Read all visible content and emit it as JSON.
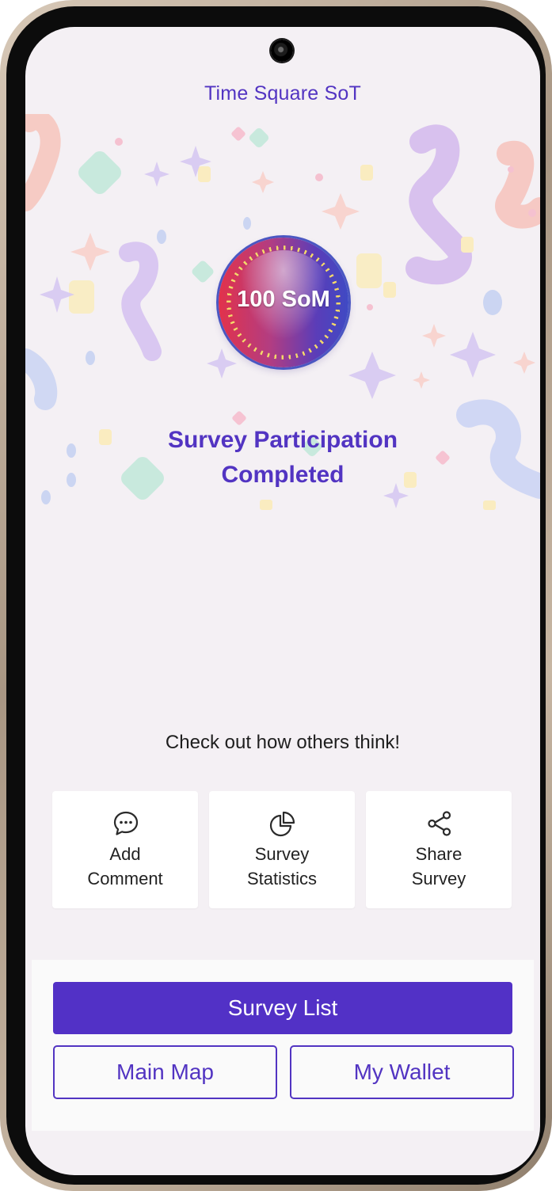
{
  "header": {
    "title": "Time Square SoT"
  },
  "badge": {
    "text": "100 SoM"
  },
  "completion": {
    "line1": "Survey Participation",
    "line2": "Completed"
  },
  "hint": "Check out how others think!",
  "actions": [
    {
      "icon": "comment-icon",
      "line1": "Add",
      "line2": "Comment"
    },
    {
      "icon": "pie-chart-icon",
      "line1": "Survey",
      "line2": "Statistics"
    },
    {
      "icon": "share-icon",
      "line1": "Share",
      "line2": "Survey"
    }
  ],
  "buttons": {
    "survey_list": "Survey List",
    "main_map": "Main Map",
    "my_wallet": "My Wallet"
  },
  "colors": {
    "accent": "#5231c6",
    "background": "#f4f0f4"
  }
}
